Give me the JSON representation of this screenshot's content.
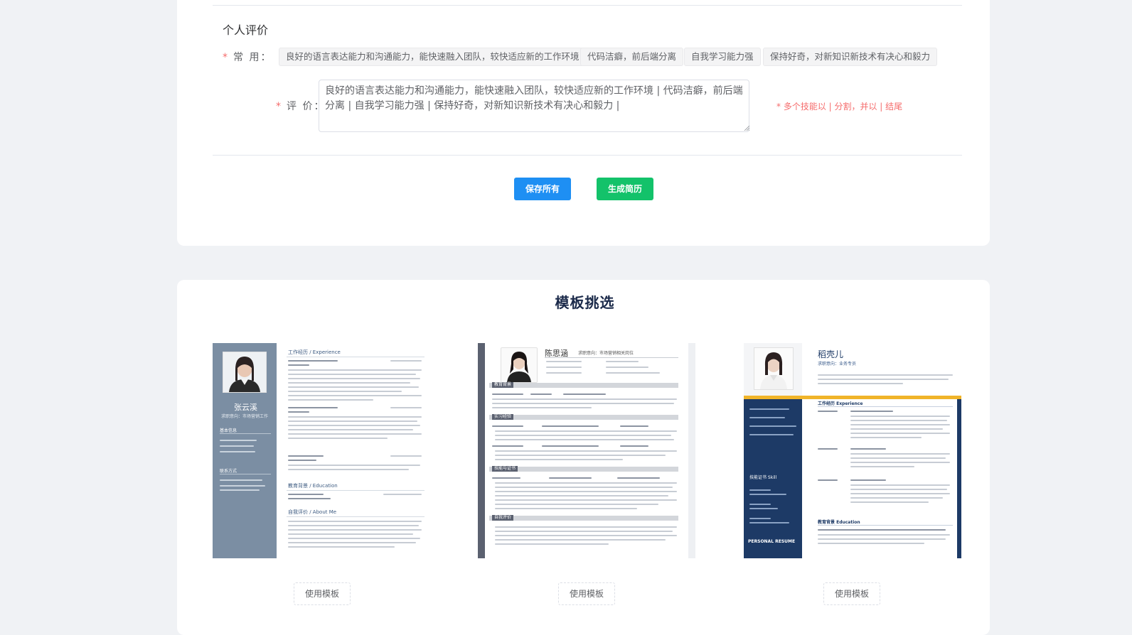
{
  "evaluation": {
    "section_title": "个人评价",
    "common_label": "常 用：",
    "tags": [
      "良好的语言表达能力和沟通能力，能快速融入团队，较快适应新的工作环境",
      "代码洁癖，前后端分离",
      "自我学习能力强",
      "保持好奇，对新知识新技术有决心和毅力"
    ],
    "eval_label": "评 价：",
    "textarea_value": "良好的语言表达能力和沟通能力，能快速融入团队，较快适应新的工作环境 | 代码洁癖，前后端分离 | 自我学习能力强 | 保持好奇，对新知识新技术有决心和毅力 |",
    "hint": "* 多个技能以 | 分割，并以 | 结尾",
    "required_mark": "*"
  },
  "actions": {
    "save_label": "保存所有",
    "generate_label": "生成简历",
    "save_color": "#1e8ff3",
    "generate_color": "#13c26a"
  },
  "templates": {
    "title": "模板挑选",
    "use_label": "使用模板",
    "items": [
      {
        "name": "张云溪",
        "intent": "求职意向：市场营销工作",
        "sections": [
          "工作经历 / Experience",
          "教育背景 / Education",
          "自我评价 / About Me"
        ],
        "side_sections": [
          "基本信息",
          "联系方式"
        ],
        "accent": "#7b8ea3"
      },
      {
        "name": "陈思涵",
        "intent": "求职意向：市场营销相关岗位",
        "sections": [
          "教育背景",
          "实习经验",
          "技能与证书",
          "自我评价"
        ],
        "accent": "#5b6170"
      },
      {
        "name": "稻壳儿",
        "intent": "求职意向：业务专员",
        "sections": [
          "工作经历 Experience",
          "教育背景 Education"
        ],
        "side_sections": [
          "技能证书 Skill"
        ],
        "footer": "PERSONAL RESUME",
        "accent": "#1d3a66",
        "accent2": "#f0b429"
      }
    ]
  }
}
